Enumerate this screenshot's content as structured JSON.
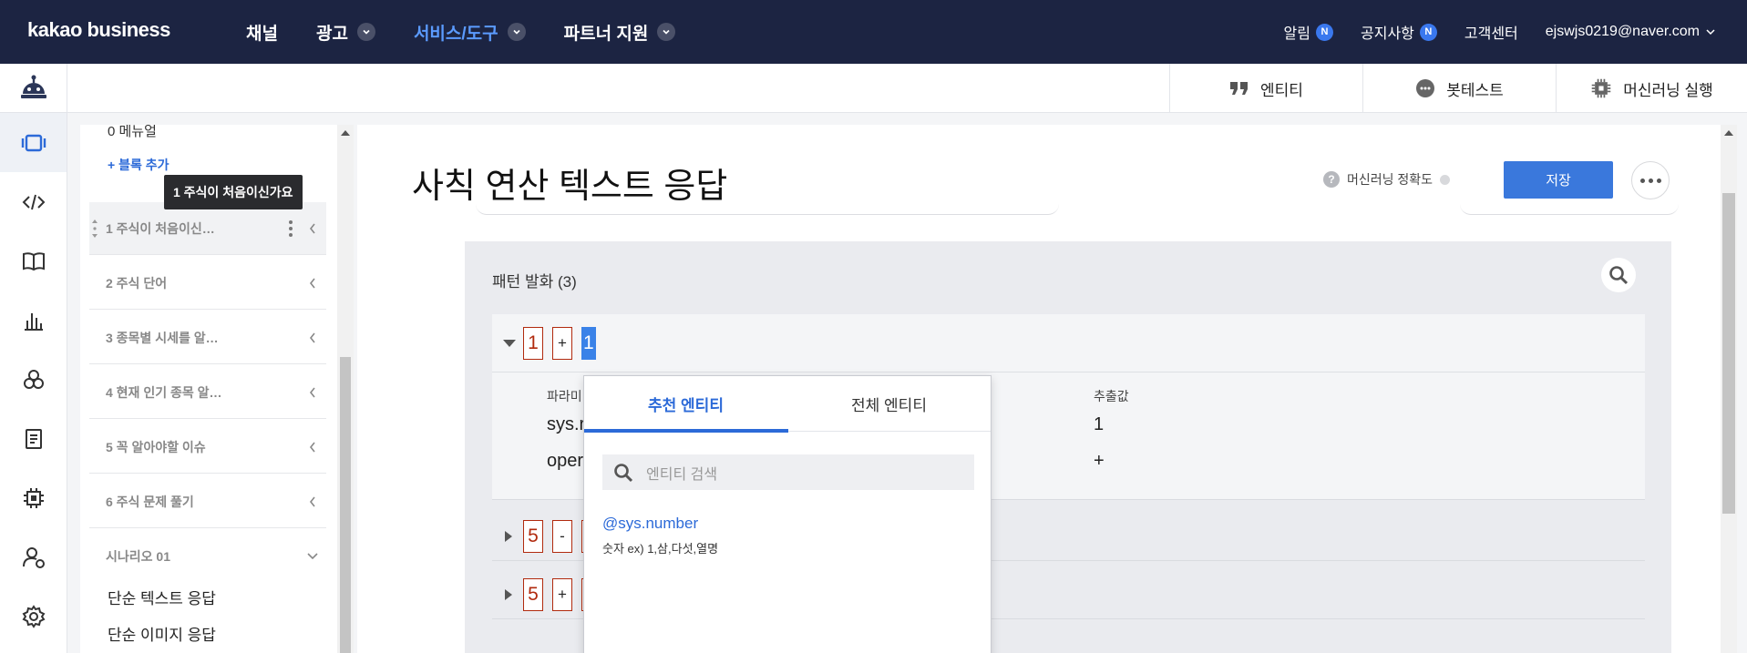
{
  "brand": {
    "logo_text": "kakao business"
  },
  "topnav": {
    "menu": [
      {
        "label": "채널",
        "has_dropdown": false
      },
      {
        "label": "광고",
        "has_dropdown": true
      },
      {
        "label": "서비스/도구",
        "has_dropdown": true,
        "active": true
      },
      {
        "label": "파트너 지원",
        "has_dropdown": true
      }
    ],
    "right": {
      "alerts_label": "알림",
      "alerts_badge": "N",
      "notice_label": "공지사항",
      "notice_badge": "N",
      "support_label": "고객센터",
      "account": "ejswjs0219@naver.com"
    }
  },
  "rail": {
    "icons": [
      "bot-icon",
      "scenario-icon",
      "code-icon",
      "book-icon",
      "chart-icon",
      "skill-icon",
      "document-icon",
      "chip-icon",
      "user-settings-icon",
      "settings-icon"
    ]
  },
  "subbar": {
    "entity_label": "엔티티",
    "bottest_label": "봇테스트",
    "ml_run_label": "머신러닝 실행"
  },
  "list": {
    "partial_top": "0 메뉴얼",
    "add_block": "+ 블록 추가",
    "tooltip": "1 주식이 처음이신가요",
    "blocks": [
      "1 주식이 처음이신…",
      "2 주식 단어",
      "3 종목별 시세를 알…",
      "4 현재 인기 종목 알…",
      "5 꼭 알아야할 이슈",
      "6 주식 문제 풀기"
    ],
    "scenario_label": "시나리오 01",
    "subitems": [
      "단순 텍스트 응답",
      "단순 이미지 응답"
    ]
  },
  "main": {
    "title": "사칙 연산 텍스트 응답",
    "accuracy_label": "머신러닝 정확도",
    "save_label": "저장",
    "pattern_title": "패턴 발화 (3)",
    "utterances": [
      {
        "tokens": [
          "1",
          "+",
          "1"
        ]
      },
      {
        "tokens": [
          "5",
          "-",
          ""
        ]
      },
      {
        "tokens": [
          "5",
          "+",
          ""
        ]
      }
    ],
    "param_header": "파라미",
    "extract_header": "추출값",
    "params": [
      {
        "name": "sys.r",
        "value": "1"
      },
      {
        "name": "oper",
        "value": "+"
      }
    ]
  },
  "dropdown": {
    "tab_recommended": "추천 엔티티",
    "tab_all": "전체 엔티티",
    "search_placeholder": "엔티티 검색",
    "entity_name": "@sys.number",
    "entity_desc": "숫자 ex) 1,삼,다섯,열명"
  },
  "colors": {
    "nav_bg": "#1c2442",
    "active_nav": "#5b9bff",
    "primary": "#3a78dc",
    "token_border": "#b12a0e"
  }
}
